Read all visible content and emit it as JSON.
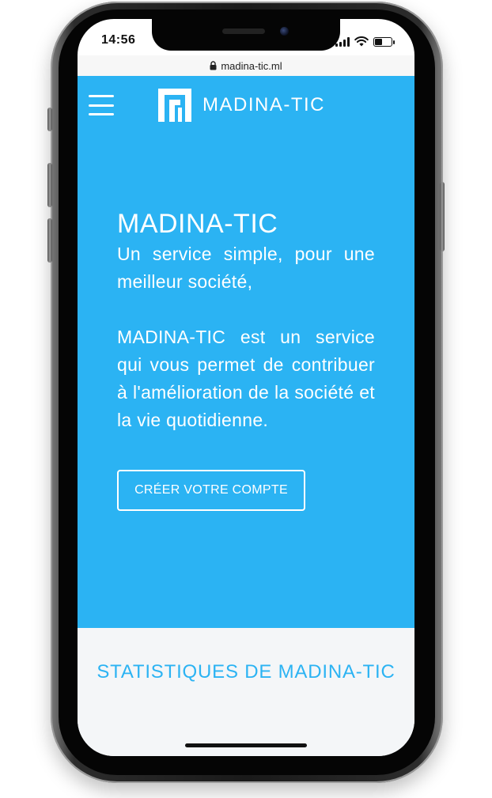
{
  "status_bar": {
    "time": "14:56",
    "signal_icon": "cellular-signal-icon",
    "wifi_icon": "wifi-icon",
    "battery_icon": "battery-icon"
  },
  "browser": {
    "url": "madina-tic.ml",
    "lock_icon": "lock-icon"
  },
  "header": {
    "menu_icon": "hamburger-menu-icon",
    "logo_icon": "madina-tic-logo-icon",
    "brand_name": "MADINA-TIC"
  },
  "hero": {
    "title": "MADINA-TIC",
    "subtitle": "Un service simple, pour une meilleur société,",
    "description": "MADINA-TIC est un service qui vous permet de contribuer à l'amélioration de la société et la vie quotidienne.",
    "cta_label": "CRÉER VOTRE COMPTE"
  },
  "stats": {
    "title": "STATISTIQUES DE MADINA-TIC"
  },
  "colors": {
    "primary": "#2bb3f3",
    "stats_background": "#f4f6f8",
    "text_on_primary": "#ffffff"
  }
}
